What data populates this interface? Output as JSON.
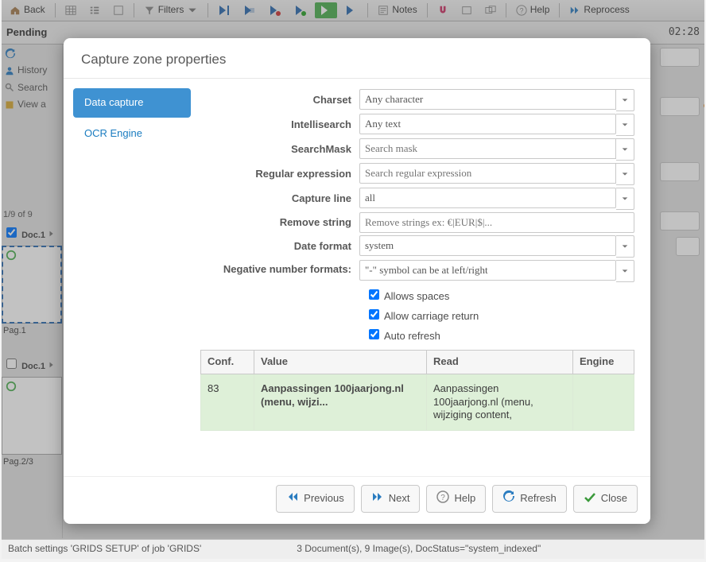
{
  "toolbar": {
    "back": "Back",
    "filters": "Filters",
    "notes": "Notes",
    "help": "Help",
    "reprocess": "Reprocess"
  },
  "row2": {
    "pending": "Pending",
    "clock": "02:28"
  },
  "leftcol": {
    "history": "History",
    "search": "Search",
    "viewall": "View a"
  },
  "pager": "1/9 of 9",
  "docs": {
    "d1": "Doc.1",
    "p1": "Pag.1",
    "d2": "Doc.1",
    "p23": "Pag.2/3"
  },
  "modal": {
    "title": "Capture zone properties",
    "tabs": {
      "datacapture": "Data capture",
      "ocrengine": "OCR Engine"
    },
    "labels": {
      "charset": "Charset",
      "intelli": "Intellisearch",
      "mask": "SearchMask",
      "regex": "Regular expression",
      "capline": "Capture line",
      "remove": "Remove string",
      "datefmt": "Date format",
      "negfmt": "Negative number formats:"
    },
    "values": {
      "charset": "Any character",
      "intelli": "Any text",
      "mask_ph": "Search mask",
      "regex_ph": "Search regular expression",
      "capline": "all",
      "remove_ph": "Remove strings ex: €|EUR|$|...",
      "datefmt": "system",
      "negfmt": "\"-\" symbol can be at left/right"
    },
    "checks": {
      "spaces": "Allows spaces",
      "cr": "Allow carriage return",
      "auto": "Auto refresh"
    },
    "table": {
      "h_conf": "Conf.",
      "h_value": "Value",
      "h_read": "Read",
      "h_engine": "Engine",
      "conf": "83",
      "value": "Aanpassingen 100jaarjong.nl (menu, wijzi...",
      "read": "Aanpassingen 100jaarjong.nl (menu, wijziging content,"
    },
    "footer": {
      "prev": "Previous",
      "next": "Next",
      "help": "Help",
      "refresh": "Refresh",
      "close": "Close"
    }
  },
  "status": {
    "left": "Batch settings 'GRIDS SETUP' of job 'GRIDS'",
    "right": "3 Document(s), 9 Image(s), DocStatus=\"system_indexed\""
  }
}
